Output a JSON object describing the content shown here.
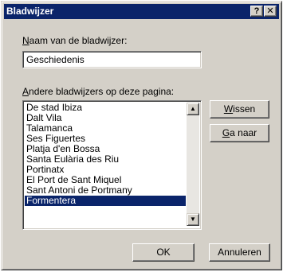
{
  "window": {
    "title": "Bladwijzer",
    "help_glyph": "?",
    "close_glyph": "✕"
  },
  "name_field": {
    "label_accel": "N",
    "label_rest": "aam van de bladwijzer:",
    "value": "Geschiedenis"
  },
  "list": {
    "label_accel": "A",
    "label_rest": "ndere bladwijzers op deze pagina:",
    "items": [
      "De stad Ibiza",
      "Dalt Vila",
      "Talamanca",
      "Ses Figuertes",
      "Platja d'en Bossa",
      "Santa Eulària des Riu",
      "Portinatx",
      "El Port de Sant Miquel",
      "Sant Antoni de Portmany",
      "Formentera"
    ],
    "selected_index": 9,
    "scroll_up_glyph": "▲",
    "scroll_down_glyph": "▼"
  },
  "buttons": {
    "wissen_accel": "W",
    "wissen_rest": "issen",
    "ganaar_accel": "G",
    "ganaar_rest": "a naar",
    "ok": "OK",
    "annuleren": "Annuleren"
  },
  "colors": {
    "face": "#d4d0c8",
    "titlebar": "#0a246a",
    "selection": "#0a246a"
  }
}
